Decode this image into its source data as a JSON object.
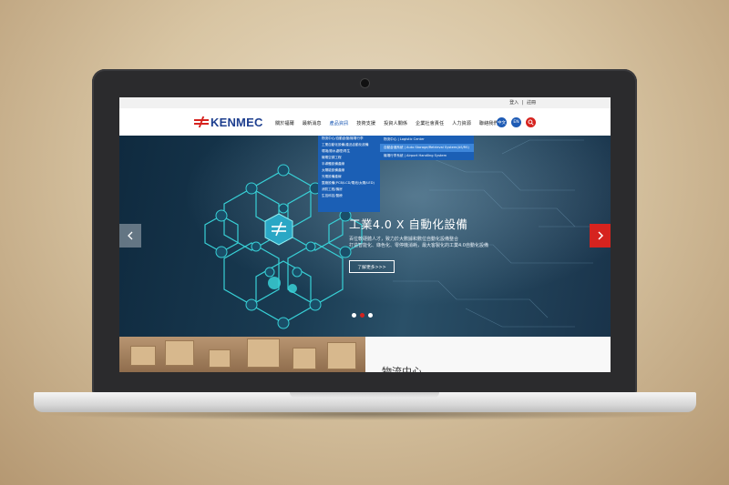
{
  "topbar": {
    "login": "登入",
    "separator": "|",
    "register": "註冊"
  },
  "brand": {
    "name": "KENMEC"
  },
  "nav": {
    "items": [
      "關於福爾",
      "最新消息",
      "產品資訊",
      "技術支援",
      "投資人關係",
      "企業社會責任",
      "人力資源",
      "聯絡我們"
    ],
    "active_index": 2
  },
  "lang": {
    "zh": "中文",
    "en": "EN"
  },
  "dropdown": {
    "items": [
      "物流中心/自動倉儲/機場行李",
      "工業自動化設備/產品自動化設備",
      "環境/廢水處理/再生",
      "機電空調工程",
      "半導體設備產線",
      "太陽能設備產線",
      "光電設備產線",
      "整廠設備(PCB/LCD/電池/太陽/LED)",
      "消防工程/機房",
      "生技科技/醫療"
    ],
    "submenu": [
      "物流中心 | Logistic Center",
      "自動倉儲系統 | Auto Storage/Retrieval System(AS/RS)",
      "機場行李系統 | Airport Handling System"
    ],
    "submenu_active_index": 1
  },
  "hero": {
    "title": "工業4.0 X 自動化設備",
    "subtitle_line1": "百位軟硬體人才，致力於大數據和數位自動化設備整合",
    "subtitle_line2": "打造智能化、綠色化、零停機消耗，最大客製化的工業4.0自動化設備",
    "more": "了解更多>>>",
    "slides": 3,
    "active_slide": 1
  },
  "section": {
    "title": "物流中心"
  },
  "colors": {
    "brand_blue": "#1e3f8f",
    "accent_red": "#d6231f",
    "menu_blue": "#1b5fb5",
    "icon_teal": "#38d0d6"
  }
}
